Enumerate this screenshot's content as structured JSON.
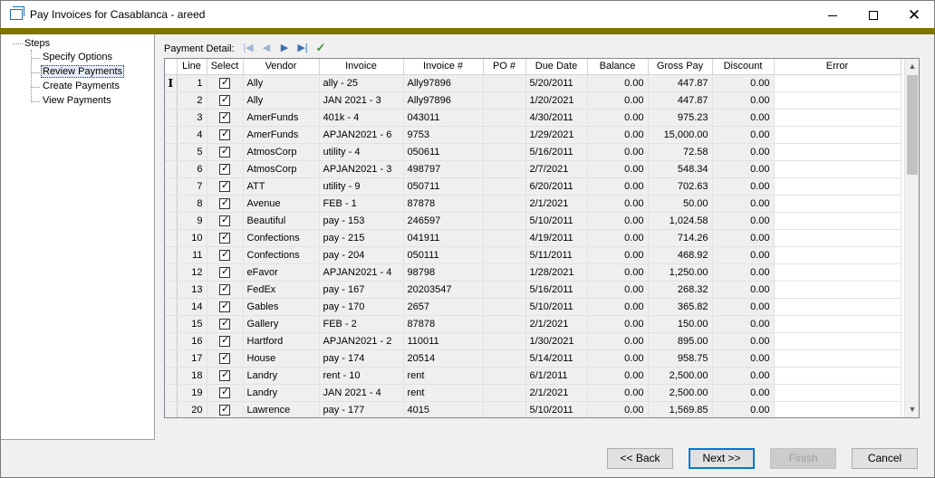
{
  "window": {
    "title": "Pay Invoices for Casablanca - areed"
  },
  "steps": {
    "root_label": "Steps",
    "items": [
      {
        "label": "Specify Options",
        "selected": false
      },
      {
        "label": "Review Payments",
        "selected": true
      },
      {
        "label": "Create Payments",
        "selected": false
      },
      {
        "label": "View Payments",
        "selected": false
      }
    ]
  },
  "payment_detail": {
    "label": "Payment Detail:",
    "nav_icons": [
      "first-record-icon",
      "prev-record-icon",
      "next-record-icon",
      "last-record-icon",
      "checkmark-icon"
    ]
  },
  "grid": {
    "columns": [
      "Line",
      "Select",
      "Vendor",
      "Invoice",
      "Invoice #",
      "PO #",
      "Due Date",
      "Balance",
      "Gross Pay",
      "Discount",
      "Error"
    ],
    "current_row_indicator": "I",
    "rows": [
      {
        "line": "1",
        "selected": true,
        "vendor": "Ally",
        "invoice": "ally - 25",
        "invoice_no": "Ally97896",
        "po": "",
        "due": "5/20/2011",
        "balance": "0.00",
        "gross": "447.87",
        "discount": "0.00",
        "error": ""
      },
      {
        "line": "2",
        "selected": true,
        "vendor": "Ally",
        "invoice": "JAN 2021 - 3",
        "invoice_no": "Ally97896",
        "po": "",
        "due": "1/20/2021",
        "balance": "0.00",
        "gross": "447.87",
        "discount": "0.00",
        "error": ""
      },
      {
        "line": "3",
        "selected": true,
        "vendor": "AmerFunds",
        "invoice": "401k - 4",
        "invoice_no": "043011",
        "po": "",
        "due": "4/30/2011",
        "balance": "0.00",
        "gross": "975.23",
        "discount": "0.00",
        "error": ""
      },
      {
        "line": "4",
        "selected": true,
        "vendor": "AmerFunds",
        "invoice": "APJAN2021 - 6",
        "invoice_no": "9753",
        "po": "",
        "due": "1/29/2021",
        "balance": "0.00",
        "gross": "15,000.00",
        "discount": "0.00",
        "error": ""
      },
      {
        "line": "5",
        "selected": true,
        "vendor": "AtmosCorp",
        "invoice": "utility - 4",
        "invoice_no": "050611",
        "po": "",
        "due": "5/16/2011",
        "balance": "0.00",
        "gross": "72.58",
        "discount": "0.00",
        "error": ""
      },
      {
        "line": "6",
        "selected": true,
        "vendor": "AtmosCorp",
        "invoice": "APJAN2021 - 3",
        "invoice_no": "498797",
        "po": "",
        "due": "2/7/2021",
        "balance": "0.00",
        "gross": "548.34",
        "discount": "0.00",
        "error": ""
      },
      {
        "line": "7",
        "selected": true,
        "vendor": "ATT",
        "invoice": "utility - 9",
        "invoice_no": "050711",
        "po": "",
        "due": "6/20/2011",
        "balance": "0.00",
        "gross": "702.63",
        "discount": "0.00",
        "error": ""
      },
      {
        "line": "8",
        "selected": true,
        "vendor": "Avenue",
        "invoice": "FEB - 1",
        "invoice_no": "87878",
        "po": "",
        "due": "2/1/2021",
        "balance": "0.00",
        "gross": "50.00",
        "discount": "0.00",
        "error": ""
      },
      {
        "line": "9",
        "selected": true,
        "vendor": "Beautiful",
        "invoice": "pay - 153",
        "invoice_no": "246597",
        "po": "",
        "due": "5/10/2011",
        "balance": "0.00",
        "gross": "1,024.58",
        "discount": "0.00",
        "error": ""
      },
      {
        "line": "10",
        "selected": true,
        "vendor": "Confections",
        "invoice": "pay - 215",
        "invoice_no": "041911",
        "po": "",
        "due": "4/19/2011",
        "balance": "0.00",
        "gross": "714.26",
        "discount": "0.00",
        "error": ""
      },
      {
        "line": "11",
        "selected": true,
        "vendor": "Confections",
        "invoice": "pay - 204",
        "invoice_no": "050111",
        "po": "",
        "due": "5/11/2011",
        "balance": "0.00",
        "gross": "468.92",
        "discount": "0.00",
        "error": ""
      },
      {
        "line": "12",
        "selected": true,
        "vendor": "eFavor",
        "invoice": "APJAN2021 - 4",
        "invoice_no": "98798",
        "po": "",
        "due": "1/28/2021",
        "balance": "0.00",
        "gross": "1,250.00",
        "discount": "0.00",
        "error": ""
      },
      {
        "line": "13",
        "selected": true,
        "vendor": "FedEx",
        "invoice": "pay - 167",
        "invoice_no": "20203547",
        "po": "",
        "due": "5/16/2011",
        "balance": "0.00",
        "gross": "268.32",
        "discount": "0.00",
        "error": ""
      },
      {
        "line": "14",
        "selected": true,
        "vendor": "Gables",
        "invoice": "pay - 170",
        "invoice_no": "2657",
        "po": "",
        "due": "5/10/2011",
        "balance": "0.00",
        "gross": "365.82",
        "discount": "0.00",
        "error": ""
      },
      {
        "line": "15",
        "selected": true,
        "vendor": "Gallery",
        "invoice": "FEB - 2",
        "invoice_no": "87878",
        "po": "",
        "due": "2/1/2021",
        "balance": "0.00",
        "gross": "150.00",
        "discount": "0.00",
        "error": ""
      },
      {
        "line": "16",
        "selected": true,
        "vendor": "Hartford",
        "invoice": "APJAN2021 - 2",
        "invoice_no": "110011",
        "po": "",
        "due": "1/30/2021",
        "balance": "0.00",
        "gross": "895.00",
        "discount": "0.00",
        "error": ""
      },
      {
        "line": "17",
        "selected": true,
        "vendor": "House",
        "invoice": "pay - 174",
        "invoice_no": "20514",
        "po": "",
        "due": "5/14/2011",
        "balance": "0.00",
        "gross": "958.75",
        "discount": "0.00",
        "error": ""
      },
      {
        "line": "18",
        "selected": true,
        "vendor": "Landry",
        "invoice": "rent - 10",
        "invoice_no": "rent",
        "po": "",
        "due": "6/1/2011",
        "balance": "0.00",
        "gross": "2,500.00",
        "discount": "0.00",
        "error": ""
      },
      {
        "line": "19",
        "selected": true,
        "vendor": "Landry",
        "invoice": "JAN 2021 - 4",
        "invoice_no": "rent",
        "po": "",
        "due": "2/1/2021",
        "balance": "0.00",
        "gross": "2,500.00",
        "discount": "0.00",
        "error": ""
      },
      {
        "line": "20",
        "selected": true,
        "vendor": "Lawrence",
        "invoice": "pay - 177",
        "invoice_no": "4015",
        "po": "",
        "due": "5/10/2011",
        "balance": "0.00",
        "gross": "1,569.85",
        "discount": "0.00",
        "error": ""
      }
    ]
  },
  "buttons": {
    "back": "<< Back",
    "next": "Next >>",
    "finish": "Finish",
    "cancel": "Cancel"
  },
  "colors": {
    "accent_strip": "#7e7400",
    "checkmark_green": "#3a9a3a",
    "nav_blue": "#3c6fb5"
  }
}
